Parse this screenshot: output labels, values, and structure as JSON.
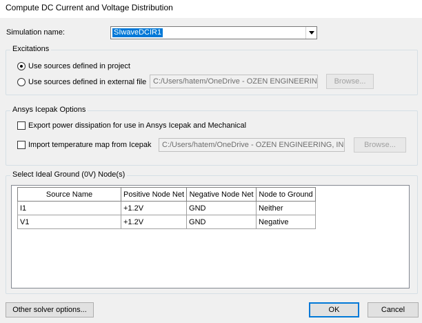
{
  "window": {
    "title": "Compute DC Current and Voltage Distribution"
  },
  "simulation": {
    "label": "Simulation name:",
    "value": "SIwaveDCIR1"
  },
  "excitations": {
    "title": "Excitations",
    "option_project": "Use sources defined in project",
    "option_external": "Use sources defined in external file",
    "path": "C:/Users/hatem/OneDrive - OZEN ENGINEERING,",
    "browse": "Browse...",
    "selected": "project"
  },
  "icepak": {
    "title": "Ansys Icepak Options",
    "export_label": "Export power dissipation for use in Ansys Icepak and Mechanical",
    "import_label": "Import temperature map from Icepak",
    "path": "C:/Users/hatem/OneDrive - OZEN ENGINEERING, INC/S",
    "browse": "Browse...",
    "export_checked": false,
    "import_checked": false
  },
  "ground": {
    "title": "Select Ideal Ground (0V) Node(s)",
    "columns": [
      "Source Name",
      "Positive Node Net",
      "Negative Node Net",
      "Node to Ground"
    ],
    "rows": [
      [
        "I1",
        "+1.2V",
        "GND",
        "Neither"
      ],
      [
        "V1",
        "+1.2V",
        "GND",
        "Negative"
      ]
    ]
  },
  "footer": {
    "other_options": "Other solver options...",
    "ok": "OK",
    "cancel": "Cancel"
  }
}
